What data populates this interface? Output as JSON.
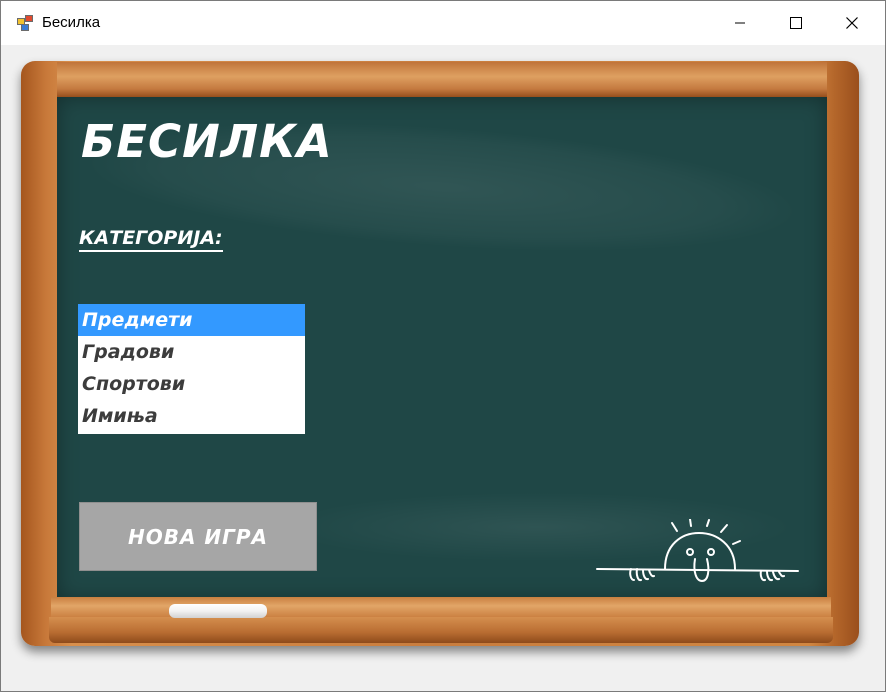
{
  "window": {
    "title": "Бесилка",
    "icons": {
      "app": "app-window-icon",
      "minimize": "minimize-icon",
      "maximize": "maximize-icon",
      "close": "close-icon"
    }
  },
  "board": {
    "title": "БЕСИЛКА",
    "category_label": "КАТЕГОРИЈА:",
    "categories": {
      "items": [
        {
          "label": "Предмети",
          "selected": true
        },
        {
          "label": "Градови",
          "selected": false
        },
        {
          "label": "Спортови",
          "selected": false
        },
        {
          "label": "Имиња",
          "selected": false
        }
      ]
    },
    "new_game_label": "НОВА ИГРА",
    "colors": {
      "chalkboard": "#1f4746",
      "frame": "#c97d3e",
      "selection": "#3399ff",
      "button": "#a6a6a6"
    },
    "decorations": [
      "chalk-stick-icon",
      "peeking-sun-doodle-icon"
    ]
  }
}
